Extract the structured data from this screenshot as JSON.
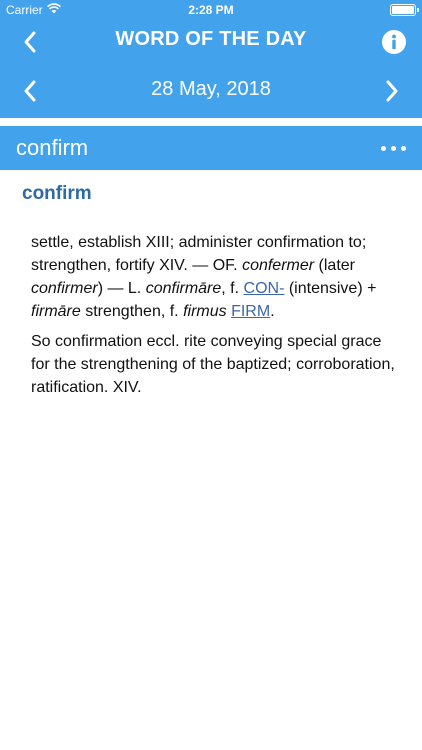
{
  "status_bar": {
    "carrier": "Carrier",
    "time": "2:28 PM"
  },
  "nav": {
    "title": "WORD OF THE DAY"
  },
  "date_bar": {
    "date": "28 May, 2018"
  },
  "word_header": {
    "word": "confirm"
  },
  "entry": {
    "headword": "confirm",
    "p1": {
      "t1": "settle, establish XIII; administer confirmation to; strengthen, fortify XIV. — OF. ",
      "i1": "confermer",
      "t2": " (later ",
      "i2": "confirmer",
      "t3": ") — L. ",
      "i3": "confirmāre",
      "t4": ", f. ",
      "link1": "CON-",
      "t5": " (intensive) + ",
      "i4": "firmāre",
      "t6": " strengthen, f. ",
      "i5": "firmus",
      "t7": " ",
      "link2": "FIRM",
      "t8": "."
    },
    "p2": "So confirmation eccl. rite conveying special grace for the strengthening of the baptized; corroboration, ratification. XIV."
  },
  "colors": {
    "header_bg": "#42a2ec",
    "headword": "#2d6aa3",
    "link": "#3b67a8"
  },
  "icons": [
    "wifi-icon",
    "battery-icon",
    "chevron-left-icon",
    "info-icon",
    "chevron-right-icon",
    "more-icon"
  ]
}
